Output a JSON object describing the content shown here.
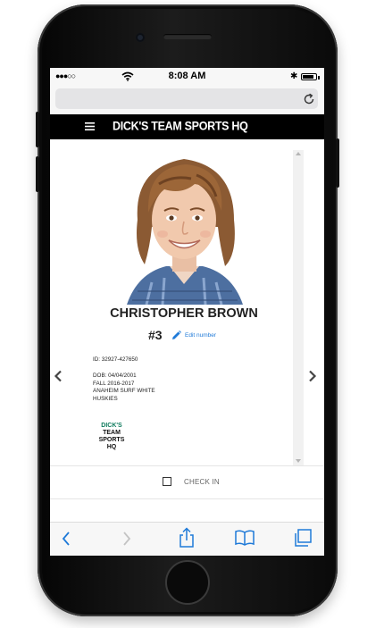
{
  "status_bar": {
    "signal": "●●●○○",
    "time": "8:08 AM",
    "bluetooth": "✱"
  },
  "site": {
    "brand": "DICK'S TEAM SPORTS HQ"
  },
  "player": {
    "name": "CHRISTOPHER BROWN",
    "number": "#3",
    "edit_link": "Edit number",
    "id_line": "ID: 32927-427650",
    "dob_line": "DOB: 04/04/2001",
    "season": "FALL 2016-2017",
    "team": "ANAHEIM SURF WHITE",
    "mascot": "HUSKIES"
  },
  "team_logo": {
    "line1": "DICK'S",
    "line2": "TEAM",
    "line3": "SPORTS",
    "line4": "HQ"
  },
  "checkin": {
    "label": "CHECK IN",
    "checked": false
  },
  "icons": {
    "menu": "hamburger-icon",
    "prev": "chevron-left-icon",
    "next": "chevron-right-icon",
    "edit": "pencil-icon",
    "reload": "reload-icon",
    "toolbar": [
      "back-icon",
      "forward-icon",
      "share-icon",
      "bookmarks-icon",
      "tabs-icon"
    ]
  },
  "colors": {
    "accent_blue": "#1f7ad8",
    "header_black": "#000000"
  }
}
